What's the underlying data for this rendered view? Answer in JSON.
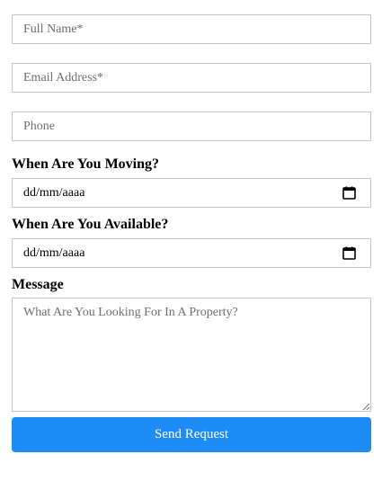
{
  "form": {
    "full_name": {
      "placeholder": "Full Name*",
      "value": ""
    },
    "email": {
      "placeholder": "Email Address*",
      "value": ""
    },
    "phone": {
      "placeholder": "Phone",
      "value": ""
    },
    "moving": {
      "label": "When Are You Moving?",
      "date_text": "dd/mm/aaaa",
      "icon": "calendar-icon"
    },
    "available": {
      "label": "When Are You Available?",
      "date_text": "dd/mm/aaaa",
      "icon": "calendar-icon"
    },
    "message": {
      "label": "Message",
      "placeholder": "What Are You Looking For In A Property?",
      "value": ""
    },
    "submit_label": "Send Request",
    "colors": {
      "button_bg": "#1e8cf7",
      "button_text": "#ffffff",
      "border": "#c4c4c4"
    }
  }
}
